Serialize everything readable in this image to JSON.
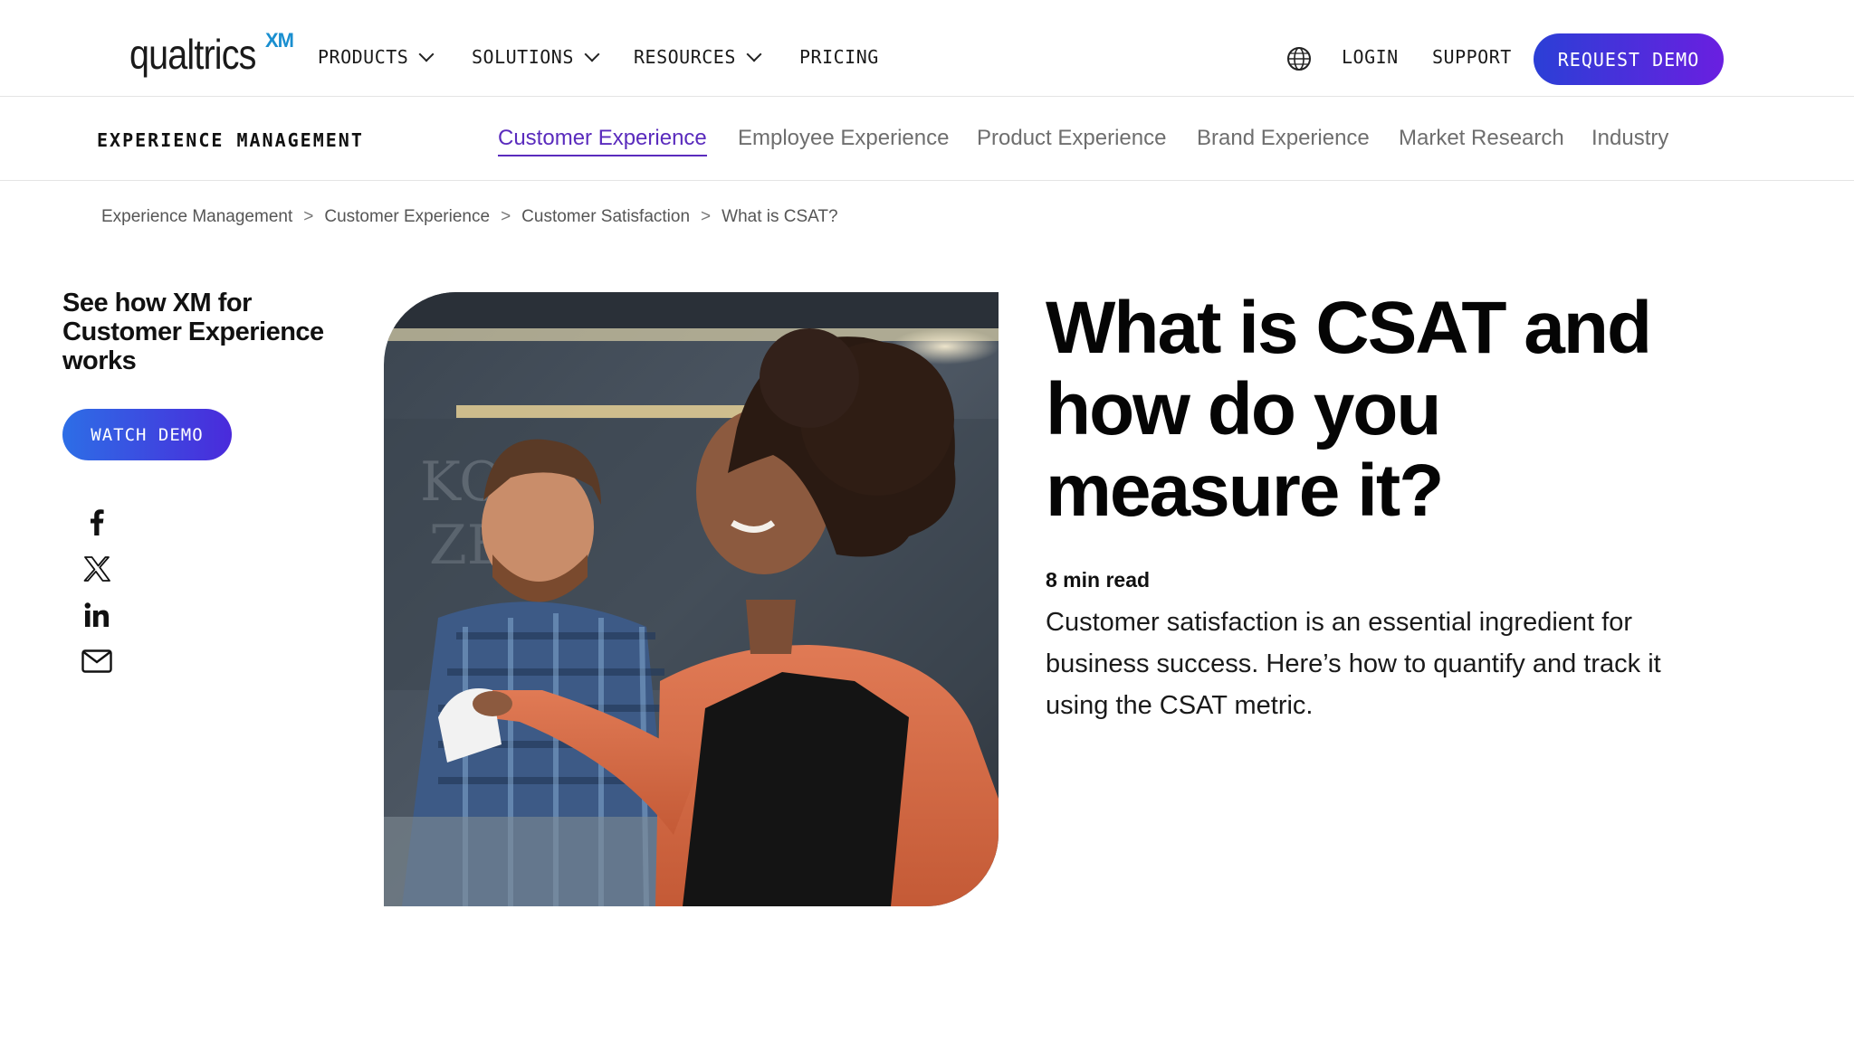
{
  "header": {
    "logo_text": "qualtrics",
    "logo_badge": "XM",
    "nav": [
      {
        "label": "PRODUCTS"
      },
      {
        "label": "SOLUTIONS"
      },
      {
        "label": "RESOURCES"
      },
      {
        "label": "PRICING"
      }
    ],
    "login": "LOGIN",
    "support": "SUPPORT",
    "request_demo": "REQUEST DEMO"
  },
  "subnav": {
    "section_label": "EXPERIENCE MANAGEMENT",
    "tabs": [
      {
        "label": "Customer Experience",
        "active": true
      },
      {
        "label": "Employee Experience"
      },
      {
        "label": "Product Experience"
      },
      {
        "label": "Brand Experience"
      },
      {
        "label": "Market Research"
      },
      {
        "label": "Industry"
      }
    ]
  },
  "breadcrumb": {
    "items": [
      "Experience Management",
      "Customer Experience",
      "Customer Satisfaction",
      "What is CSAT?"
    ],
    "separator": ">"
  },
  "sidebar": {
    "cta_title": "See how XM for Customer Experience works",
    "watch_demo": "WATCH DEMO",
    "share_icons": [
      "facebook-icon",
      "x-icon",
      "linkedin-icon",
      "email-icon"
    ]
  },
  "article": {
    "title": "What is CSAT and how do you measure it?",
    "read_time": "8 min read",
    "summary": "Customer satisfaction is an essential ingredient for business success. Here’s how to quantify and track it using the CSAT metric."
  },
  "colors": {
    "accent": "#5a2bbd",
    "button_gradient_start": "#2b3fd6",
    "button_gradient_end": "#6a1fe0"
  }
}
